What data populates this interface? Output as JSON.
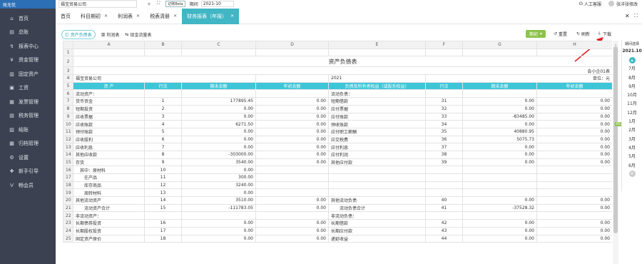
{
  "app": {
    "logo": "账无忧",
    "company": "福宝贸易公司",
    "period_label": "期间",
    "period_value": "2021-10",
    "badge": "记账Beta",
    "help": "人工客服",
    "user": "张洋张修改"
  },
  "sidebar": [
    {
      "icon": "⌂",
      "label": "首页"
    },
    {
      "icon": "▤",
      "label": "总账"
    },
    {
      "icon": "↯",
      "label": "报表中心"
    },
    {
      "icon": "¥",
      "label": "资金管理"
    },
    {
      "icon": "▥",
      "label": "固定资产"
    },
    {
      "icon": "▣",
      "label": "工资"
    },
    {
      "icon": "▦",
      "label": "发票管理"
    },
    {
      "icon": "▧",
      "label": "税务管理"
    },
    {
      "icon": "▨",
      "label": "结账"
    },
    {
      "icon": "▩",
      "label": "归档管理"
    },
    {
      "icon": "⚙",
      "label": "设置"
    },
    {
      "icon": "✚",
      "label": "新手引导"
    },
    {
      "icon": "V",
      "label": "畅会员"
    }
  ],
  "tabs": [
    {
      "label": "首页",
      "active": false
    },
    {
      "label": "科目期初",
      "active": false
    },
    {
      "label": "利润表",
      "active": false
    },
    {
      "label": "税表清册",
      "active": false
    },
    {
      "label": "财务报表（年报）",
      "active": true
    }
  ],
  "subtabs": [
    {
      "label": "资产负债表",
      "active": true
    },
    {
      "label": "利润表",
      "active": false
    },
    {
      "label": "现金流量表",
      "active": false
    }
  ],
  "toolbar": {
    "period_btn": "期初",
    "refresh": "重置",
    "reload": "刷新",
    "download": "下载"
  },
  "columns": [
    "A",
    "B",
    "C",
    "D",
    "E",
    "F",
    "G",
    "H"
  ],
  "sheet": {
    "title": "资产负债表",
    "form_no": "会小企01表",
    "unit": "单位：元",
    "company": "福宝贸易公司",
    "year": "2021",
    "headers": [
      "资 产",
      "行次",
      "期末余额",
      "年初余额",
      "负债及所有者权益（或股东权益）",
      "行次",
      "期末余额",
      "年初余额"
    ]
  },
  "rows": [
    {
      "n": "6",
      "a": "流动资产：",
      "b": "",
      "c": "",
      "d": "",
      "e": "流动负债：",
      "f": "",
      "g": "",
      "h": ""
    },
    {
      "n": "7",
      "a": "货币资金",
      "b": "1",
      "c": "177895.45",
      "d": "0.00",
      "e": "短期借款",
      "f": "31",
      "g": "0.00",
      "h": "0.00"
    },
    {
      "n": "8",
      "a": "短期投资",
      "b": "2",
      "c": "0.00",
      "d": "0.00",
      "e": "应付票据",
      "f": "32",
      "g": "0.00",
      "h": "0.00"
    },
    {
      "n": "9",
      "a": "应收票据",
      "b": "3",
      "c": "0.00",
      "d": "0.00",
      "e": "应付账款",
      "f": "33",
      "g": "-83485.00",
      "h": "0.00"
    },
    {
      "n": "10",
      "a": "应收账款",
      "b": "4",
      "c": "6271.50",
      "d": "0.00",
      "e": "预收账款",
      "f": "34",
      "g": "0.00",
      "h": "0.00"
    },
    {
      "n": "11",
      "a": "预付账款",
      "b": "5",
      "c": "0.00",
      "d": "0.00",
      "e": "应付职工薪酬",
      "f": "35",
      "g": "40880.95",
      "h": "0.00"
    },
    {
      "n": "12",
      "a": "应收股利",
      "b": "6",
      "c": "0.00",
      "d": "0.00",
      "e": "应交税费",
      "f": "36",
      "g": "5075.73",
      "h": "0.00"
    },
    {
      "n": "13",
      "a": "应收利息",
      "b": "7",
      "c": "0.00",
      "d": "0.00",
      "e": "应付利息",
      "f": "37",
      "g": "0.00",
      "h": "0.00"
    },
    {
      "n": "14",
      "a": "其他应收款",
      "b": "8",
      "c": "-303000.00",
      "d": "0.00",
      "e": "应付利润",
      "f": "38",
      "g": "0.00",
      "h": "0.00"
    },
    {
      "n": "15",
      "a": "存货",
      "b": "9",
      "c": "3540.00",
      "d": "0.00",
      "e": "其他应付款",
      "f": "39",
      "g": "0.00",
      "h": "0.00"
    },
    {
      "n": "16",
      "a": "　其中：原材料",
      "b": "10",
      "c": "0.00",
      "d": "",
      "e": "",
      "f": "",
      "g": "",
      "h": ""
    },
    {
      "n": "17",
      "a": "　　在产品",
      "b": "11",
      "c": "300.00",
      "d": "",
      "e": "",
      "f": "",
      "g": "",
      "h": ""
    },
    {
      "n": "18",
      "a": "　　库存商品",
      "b": "12",
      "c": "3240.00",
      "d": "",
      "e": "",
      "f": "",
      "g": "",
      "h": ""
    },
    {
      "n": "19",
      "a": "　　周转材料",
      "b": "13",
      "c": "0.00",
      "d": "",
      "e": "",
      "f": "",
      "g": "",
      "h": ""
    },
    {
      "n": "20",
      "a": "其他流动资产",
      "b": "14",
      "c": "3510.00",
      "d": "0.00",
      "e": "其他流动负债",
      "f": "40",
      "g": "0.00",
      "h": "0.00"
    },
    {
      "n": "21",
      "a": "　　流动资产合计",
      "b": "15",
      "c": "-111783.05",
      "d": "0.00",
      "e": "　　流动负债合计",
      "f": "41",
      "g": "-37528.32",
      "h": "0.00"
    },
    {
      "n": "22",
      "a": "非流动资产：",
      "b": "",
      "c": "",
      "d": "",
      "e": "非流动负债：",
      "f": "",
      "g": "",
      "h": ""
    },
    {
      "n": "23",
      "a": "长期债券投资",
      "b": "16",
      "c": "0.00",
      "d": "0.00",
      "e": "长期借款",
      "f": "42",
      "g": "0.00",
      "h": "0.00"
    },
    {
      "n": "24",
      "a": "长期股权投资",
      "b": "17",
      "c": "0.00",
      "d": "0.00",
      "e": "长期应付款",
      "f": "43",
      "g": "0.00",
      "h": "0.00"
    },
    {
      "n": "25",
      "a": "固定资产原价",
      "b": "18",
      "c": "0.00",
      "d": "0.00",
      "e": "递延收益",
      "f": "44",
      "g": "0.00",
      "h": "0.00"
    }
  ],
  "period_panel": {
    "title": "期间选择",
    "year": "2021.10",
    "months": [
      "7月",
      "8月",
      "9月",
      "10月",
      "11月",
      "12月",
      "1月",
      "2月",
      "3月",
      "4月",
      "5月",
      "6月"
    ],
    "year_tag": "2021"
  }
}
